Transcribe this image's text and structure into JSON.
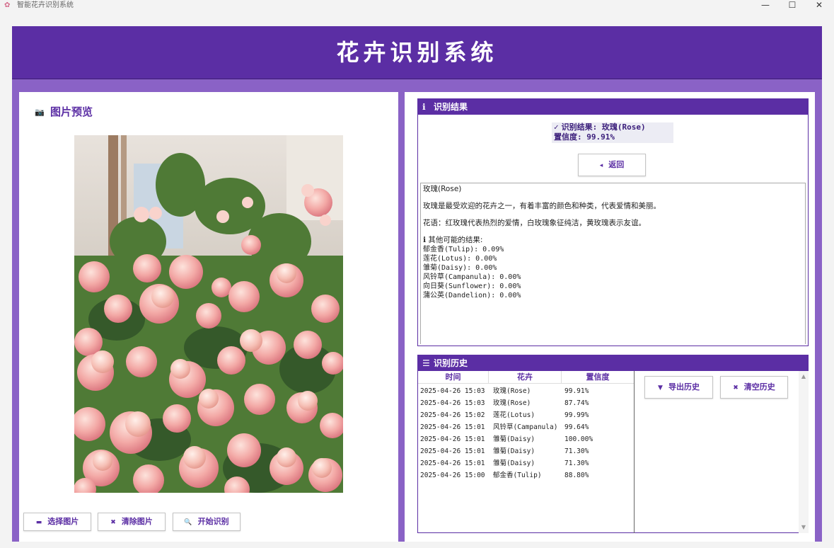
{
  "window": {
    "title": "智能花卉识别系统",
    "icons": {
      "app": "flower-icon",
      "minimize": "minimize-icon",
      "maximize": "maximize-icon",
      "close": "close-icon"
    }
  },
  "header": {
    "title": "花卉识别系统"
  },
  "preview_panel": {
    "title": "图片预览",
    "buttons": {
      "select": "选择图片",
      "clear": "清除图片",
      "start": "开始识别"
    }
  },
  "result_panel": {
    "title": "识别结果",
    "result_label": "识别结果: 玫瑰(Rose)",
    "confidence_label": "置信度: 99.91%",
    "back_button": "返回",
    "detail": {
      "name": "玫瑰(Rose)",
      "description": "玫瑰是最受欢迎的花卉之一，有着丰富的颜色和种类，代表爱情和美丽。",
      "flower_language": "花语：红玫瑰代表热烈的爱情，白玫瑰象征纯洁，黄玫瑰表示友谊。",
      "others_title": "其他可能的结果:",
      "others": [
        "郁金香(Tulip): 0.09%",
        "莲花(Lotus): 0.00%",
        "雏菊(Daisy): 0.00%",
        "风铃草(Campanula): 0.00%",
        "向日葵(Sunflower): 0.00%",
        "蒲公英(Dandelion): 0.00%"
      ]
    }
  },
  "history_panel": {
    "title": "识别历史",
    "columns": [
      "时间",
      "花卉",
      "置信度"
    ],
    "rows": [
      {
        "time": "2025-04-26 15:03",
        "flower": "玫瑰(Rose)",
        "confidence": "99.91%"
      },
      {
        "time": "2025-04-26 15:03",
        "flower": "玫瑰(Rose)",
        "confidence": "87.74%"
      },
      {
        "time": "2025-04-26 15:02",
        "flower": "莲花(Lotus)",
        "confidence": "99.99%"
      },
      {
        "time": "2025-04-26 15:01",
        "flower": "风铃草(Campanula)",
        "confidence": "99.64%"
      },
      {
        "time": "2025-04-26 15:01",
        "flower": "雏菊(Daisy)",
        "confidence": "100.00%"
      },
      {
        "time": "2025-04-26 15:01",
        "flower": "雏菊(Daisy)",
        "confidence": "71.30%"
      },
      {
        "time": "2025-04-26 15:01",
        "flower": "雏菊(Daisy)",
        "confidence": "71.30%"
      },
      {
        "time": "2025-04-26 15:00",
        "flower": "郁金香(Tulip)",
        "confidence": "88.80%"
      }
    ],
    "buttons": {
      "export": "导出历史",
      "clear": "清空历史"
    }
  },
  "colors": {
    "header": "#5b2ea4",
    "frame": "#8a62c6",
    "accent": "#5b2ea4"
  }
}
